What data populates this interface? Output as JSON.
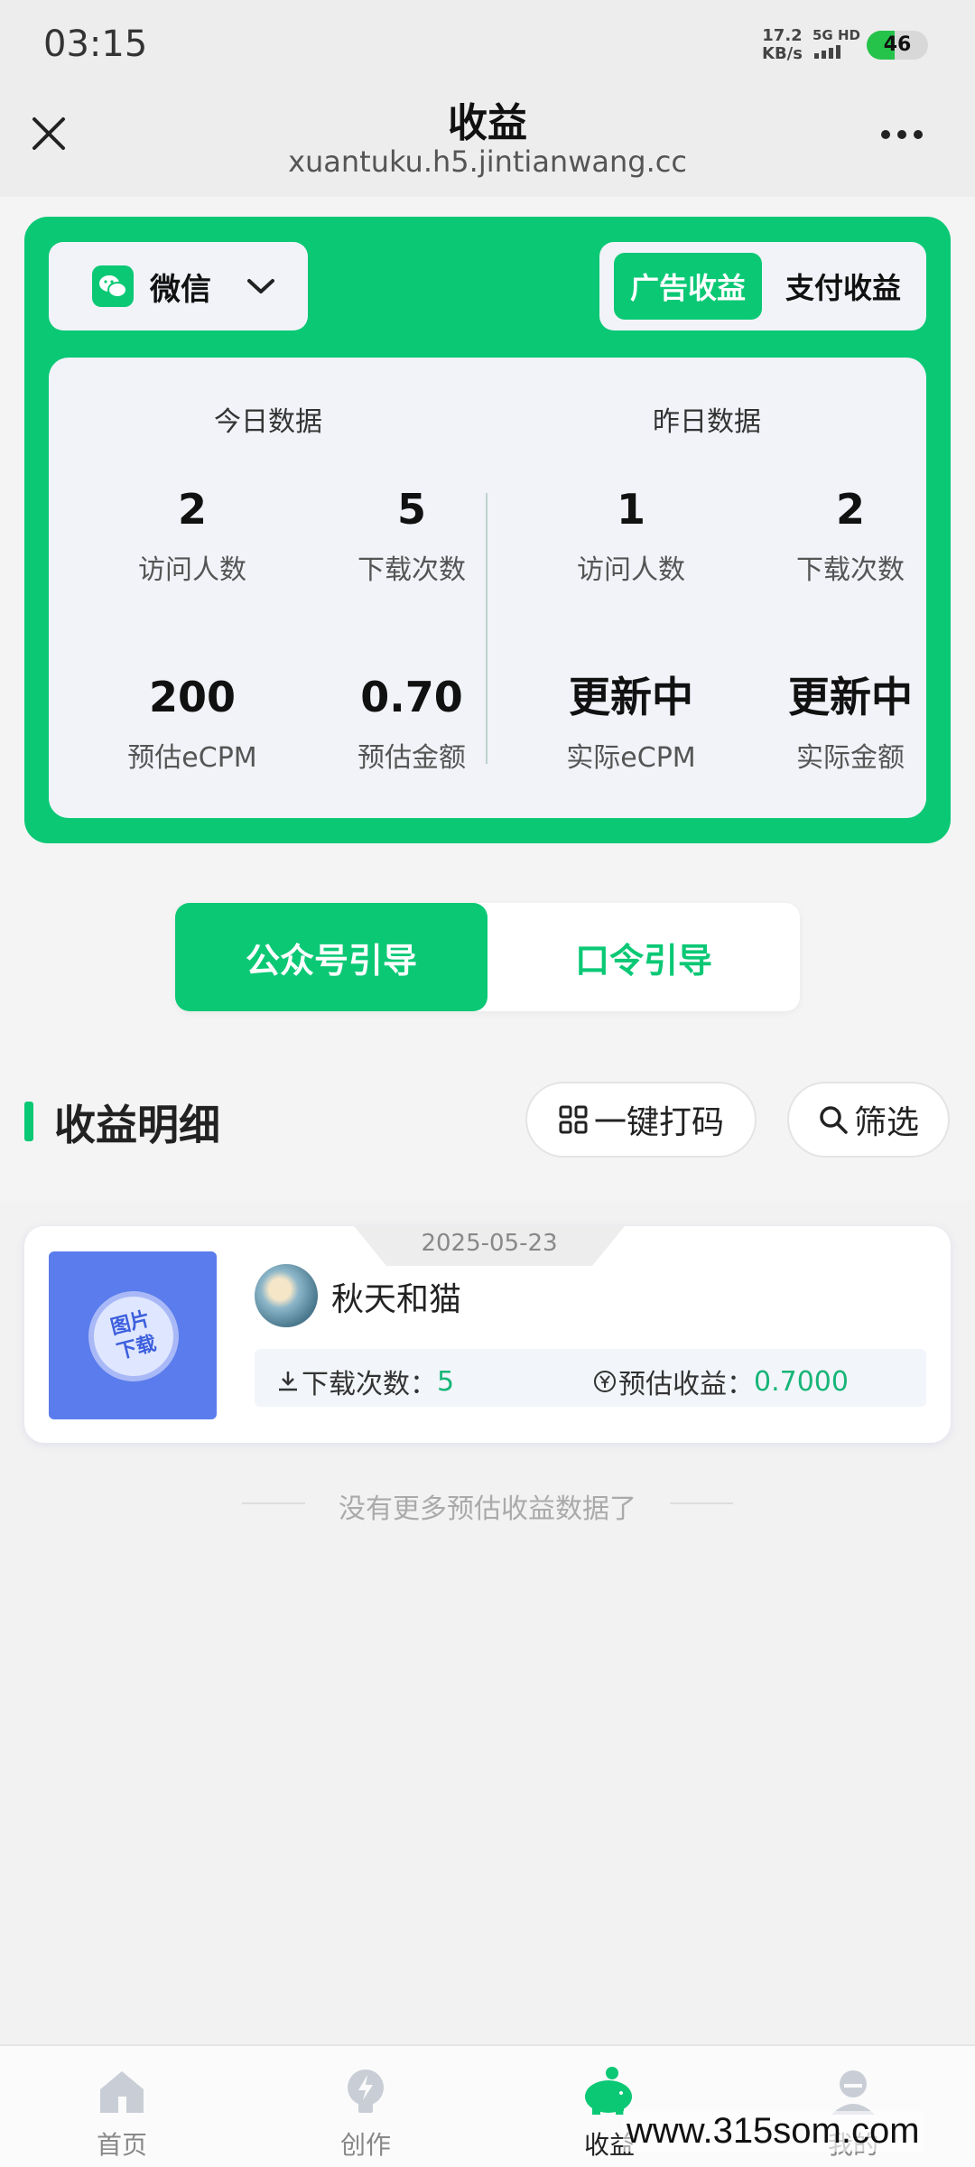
{
  "status_bar": {
    "time": "03:15",
    "net_speed": "17.2",
    "net_unit": "KB/s",
    "signal": "5G HD",
    "battery": "46"
  },
  "header": {
    "title": "收益",
    "url": "xuantuku.h5.jintianwang.cc"
  },
  "panel": {
    "platform": "微信",
    "tabs": {
      "ad": "广告收益",
      "pay": "支付收益"
    },
    "today": {
      "title": "今日数据",
      "visitors": {
        "value": "2",
        "label": "访问人数"
      },
      "downloads": {
        "value": "5",
        "label": "下载次数"
      },
      "ecpm": {
        "value": "200",
        "label": "预估eCPM"
      },
      "amount": {
        "value": "0.70",
        "label": "预估金额"
      }
    },
    "yesterday": {
      "title": "昨日数据",
      "visitors": {
        "value": "1",
        "label": "访问人数"
      },
      "downloads": {
        "value": "2",
        "label": "下载次数"
      },
      "ecpm": {
        "value": "更新中",
        "label": "实际eCPM"
      },
      "amount": {
        "value": "更新中",
        "label": "实际金额"
      }
    }
  },
  "guide": {
    "left": "公众号引导",
    "right": "口令引导"
  },
  "section": {
    "title": "收益明细",
    "code_button": "一键打码",
    "filter_button": "筛选"
  },
  "record": {
    "date": "2025-05-23",
    "thumb_line1": "图片",
    "thumb_line2": "下载",
    "name": "秋天和猫",
    "downloads_label": "下载次数：",
    "downloads_value": "5",
    "income_label": "预估收益：",
    "income_value": "0.7000"
  },
  "no_more": "没有更多预估收益数据了",
  "nav": {
    "home": "首页",
    "create": "创作",
    "income": "收益",
    "me": "我的"
  },
  "watermark": "www.315som.com",
  "colors": {
    "brand": "#0bc875",
    "accent_text": "#17b578"
  }
}
